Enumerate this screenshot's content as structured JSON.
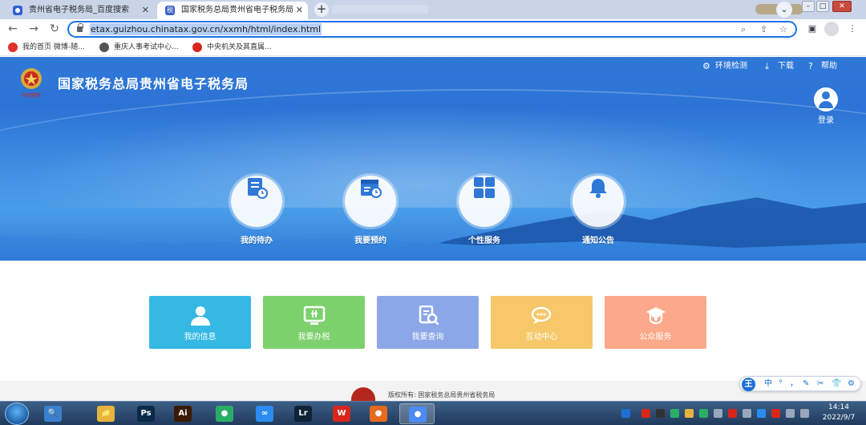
{
  "browser": {
    "tabs": [
      {
        "title": "贵州省电子税务局_百度搜索",
        "close": "✕"
      },
      {
        "title": "国家税务总局贵州省电子税务局",
        "close": "✕",
        "favicon_text": "税"
      }
    ],
    "new_tab": "+",
    "tab_search": "⌄",
    "window_controls": {
      "minimize": "–",
      "maximize": "□",
      "close": "✕"
    },
    "nav": {
      "back": "←",
      "forward": "→",
      "reload": "↻"
    },
    "url": "etax.guizhou.chinatax.gov.cn/xxmh/html/index.html",
    "omnibox_icons": {
      "zoom": "⌕",
      "share": "⇪",
      "star": "☆"
    },
    "toolbar_icons": {
      "side_panel": "▣",
      "profile": "●",
      "menu": "⋮"
    },
    "bookmarks": [
      {
        "label": "我的首页 微博-随...",
        "color": "#e0302a"
      },
      {
        "label": "重庆人事考试中心...",
        "color": "#555555"
      },
      {
        "label": "中央机关及其直属...",
        "color": "#d8261c"
      }
    ]
  },
  "page": {
    "title": "国家税务总局贵州省电子税务局",
    "logo_caption": "中国税务",
    "top_links": [
      {
        "label": "环境检测",
        "icon": "⚙"
      },
      {
        "label": "下载",
        "icon": "⤓"
      },
      {
        "label": "帮助",
        "icon": "?"
      }
    ],
    "login": "登录",
    "services": [
      {
        "label": "我的待办"
      },
      {
        "label": "我要预约"
      },
      {
        "label": "个性服务"
      },
      {
        "label": "通知公告"
      }
    ],
    "tiles": [
      {
        "label": "我的信息",
        "color": "#35b9e4"
      },
      {
        "label": "我要办税",
        "color": "#7dd16d"
      },
      {
        "label": "我要查询",
        "color": "#8ca7e8"
      },
      {
        "label": "互动中心",
        "color": "#f6c86a"
      },
      {
        "label": "公众服务",
        "color": "#fba98a"
      }
    ],
    "copyright": "版权所有: 国家税务总局贵州省税务局",
    "accent": "#2f78d8"
  },
  "ime": {
    "logo": "王",
    "items": [
      "中",
      "°",
      "，",
      "✎",
      "✂",
      "👕",
      "⚙"
    ]
  },
  "taskbar": {
    "apps": [
      {
        "name": "search",
        "glyph": "🔍",
        "color": "#3b7fd0"
      },
      {
        "name": "explorer",
        "glyph": "📁",
        "color": "#e6b43c"
      },
      {
        "name": "photoshop",
        "glyph": "Ps",
        "color": "#0b2a4a"
      },
      {
        "name": "illustrator",
        "glyph": "Ai",
        "color": "#3a1a00"
      },
      {
        "name": "wechat",
        "glyph": "●",
        "color": "#2aae67"
      },
      {
        "name": "baidu-netdisk",
        "glyph": "∞",
        "color": "#2c8bf0"
      },
      {
        "name": "lightroom",
        "glyph": "Lr",
        "color": "#0f2436"
      },
      {
        "name": "wps",
        "glyph": "W",
        "color": "#d8261c"
      },
      {
        "name": "firefox",
        "glyph": "●",
        "color": "#e66a1f"
      },
      {
        "name": "chrome",
        "glyph": "●",
        "color": "#4b8bf4"
      }
    ],
    "time": "14:14",
    "date": "2022/9/7"
  }
}
